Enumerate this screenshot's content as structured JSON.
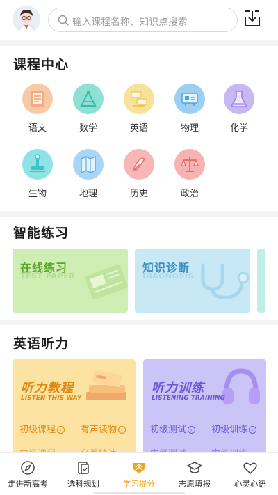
{
  "header": {
    "search_placeholder": "输入课程名称、知识点搜索"
  },
  "course_center": {
    "title": "课程中心",
    "items": [
      {
        "label": "语文",
        "icon": "chinese-icon",
        "color": "#f7c9a4"
      },
      {
        "label": "数学",
        "icon": "math-icon",
        "color": "#8fe0d4"
      },
      {
        "label": "英语",
        "icon": "english-icon",
        "color": "#f7e29b"
      },
      {
        "label": "物理",
        "icon": "physics-icon",
        "color": "#9ccff2"
      },
      {
        "label": "化学",
        "icon": "chemistry-icon",
        "color": "#c7b7f3"
      },
      {
        "label": "生物",
        "icon": "biology-icon",
        "color": "#8ee3e6"
      },
      {
        "label": "地理",
        "icon": "geography-icon",
        "color": "#a9d6f7"
      },
      {
        "label": "历史",
        "icon": "history-icon",
        "color": "#f6b7b5"
      },
      {
        "label": "政治",
        "icon": "politics-icon",
        "color": "#f6b3b1"
      }
    ]
  },
  "practice": {
    "title": "智能练习",
    "cards": [
      {
        "title": "在线练习",
        "subtitle": "TEST PAPER",
        "color": "#cfeeb3",
        "text_color": "#5aa52c"
      },
      {
        "title": "知识诊断",
        "subtitle": "DIAGNOSIS",
        "color": "#c8e8f6",
        "text_color": "#3a8fc2"
      }
    ]
  },
  "listening": {
    "title": "英语听力",
    "cards": [
      {
        "title": "听力教程",
        "subtitle": "LISTEN THIS WAY",
        "link1": "初级课程",
        "link2": "有声读物",
        "peek1": "中级课程",
        "peek2": "名著精读",
        "color": "#fde3a1",
        "text_color": "#e0860f"
      },
      {
        "title": "听力训练",
        "subtitle": "LISTENING TRAINING",
        "link1": "初级测试",
        "link2": "初级训练",
        "peek1": "中级测试",
        "peek2": "中级训练",
        "color": "#cbc5f7",
        "text_color": "#6b55d6"
      }
    ]
  },
  "tabbar": {
    "active_color": "#f3a21a",
    "tabs": [
      {
        "label": "走进新高考",
        "icon": "compass-icon"
      },
      {
        "label": "选科规划",
        "icon": "plan-icon"
      },
      {
        "label": "学习提分",
        "icon": "study-icon"
      },
      {
        "label": "志愿填报",
        "icon": "graduation-cap-icon"
      },
      {
        "label": "心灵心语",
        "icon": "heart-icon"
      }
    ]
  }
}
